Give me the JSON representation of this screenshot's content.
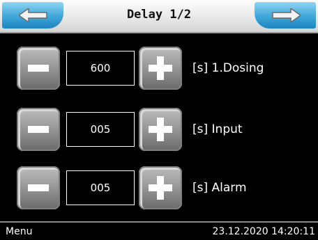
{
  "header": {
    "title": "Delay 1/2",
    "back_icon": "arrow-left-icon",
    "forward_icon": "arrow-right-icon",
    "accent_color": "#3fa6d8"
  },
  "rows": [
    {
      "value": "600",
      "label": "[s] 1.Dosing"
    },
    {
      "value": "005",
      "label": "[s] Input"
    },
    {
      "value": "005",
      "label": "[s] Alarm"
    }
  ],
  "footer": {
    "menu_label": "Menu",
    "datetime": "23.12.2020 14:20:11"
  }
}
